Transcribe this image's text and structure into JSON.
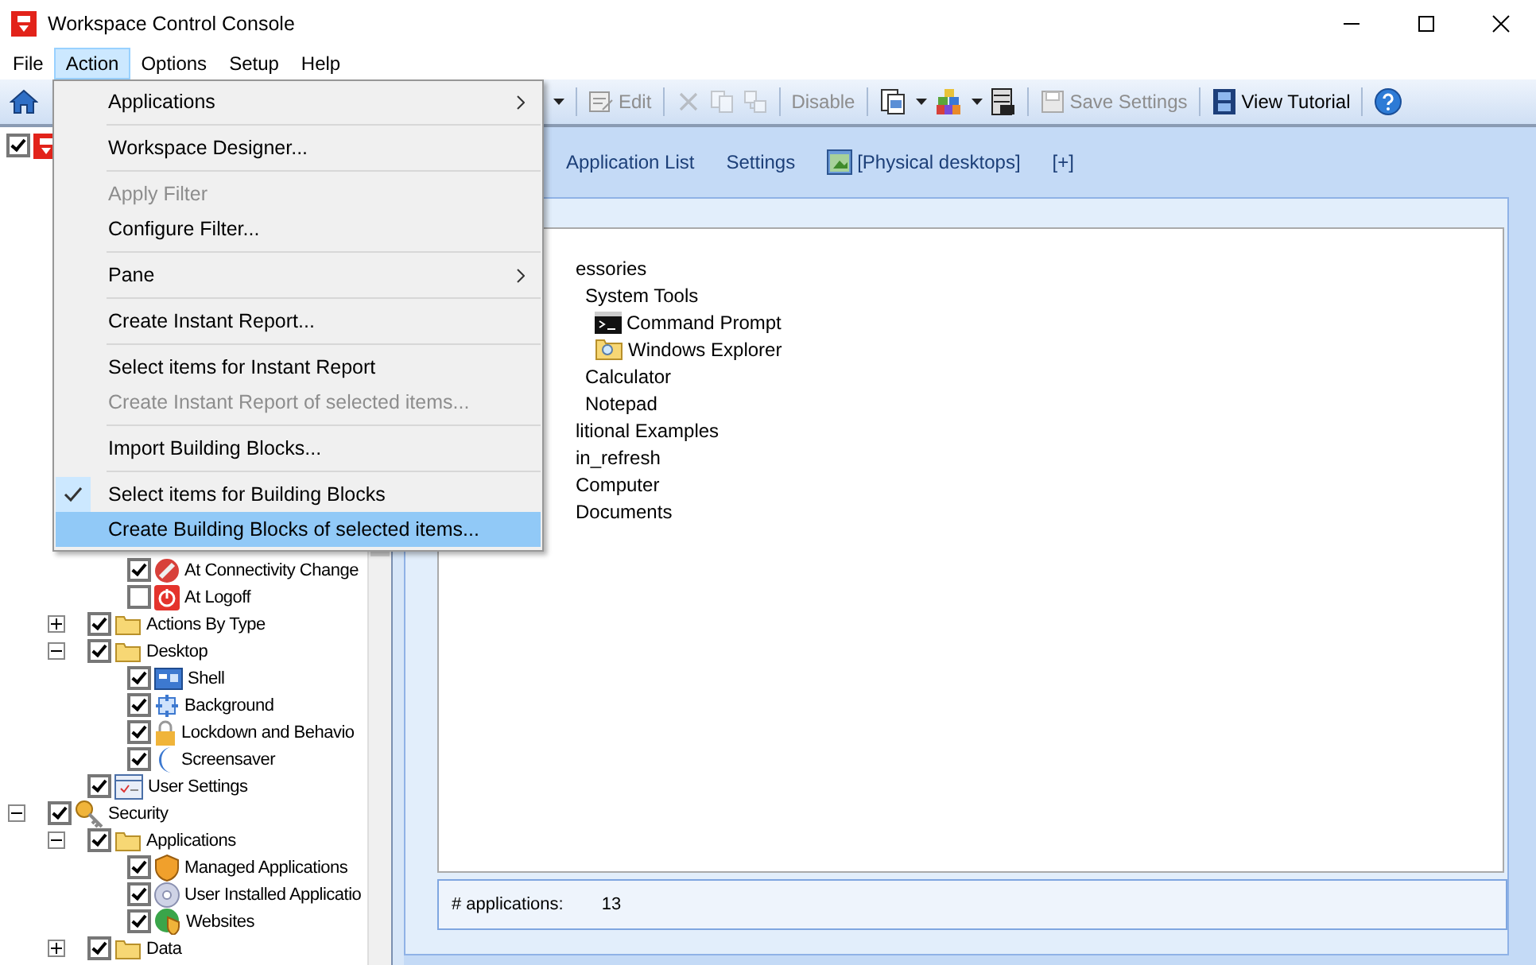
{
  "window": {
    "title": "Workspace Control Console"
  },
  "menubar": [
    {
      "label": "File",
      "selected": false
    },
    {
      "label": "Action",
      "selected": true
    },
    {
      "label": "Options",
      "selected": false
    },
    {
      "label": "Setup",
      "selected": false
    },
    {
      "label": "Help",
      "selected": false
    }
  ],
  "menu": [
    {
      "kind": "item",
      "label": "Applications",
      "submenu": true,
      "disabled": false,
      "checked": false,
      "selected": false
    },
    {
      "kind": "separator"
    },
    {
      "kind": "item",
      "label": "Workspace Designer...",
      "submenu": false,
      "disabled": false,
      "checked": false,
      "selected": false
    },
    {
      "kind": "separator"
    },
    {
      "kind": "item",
      "label": "Apply Filter",
      "submenu": false,
      "disabled": true,
      "checked": false,
      "selected": false
    },
    {
      "kind": "item",
      "label": "Configure Filter...",
      "submenu": false,
      "disabled": false,
      "checked": false,
      "selected": false
    },
    {
      "kind": "separator"
    },
    {
      "kind": "item",
      "label": "Pane",
      "submenu": true,
      "disabled": false,
      "checked": false,
      "selected": false
    },
    {
      "kind": "separator"
    },
    {
      "kind": "item",
      "label": "Create Instant Report...",
      "submenu": false,
      "disabled": false,
      "checked": false,
      "selected": false
    },
    {
      "kind": "separator"
    },
    {
      "kind": "item",
      "label": "Select items for Instant Report",
      "submenu": false,
      "disabled": false,
      "checked": false,
      "selected": false
    },
    {
      "kind": "item",
      "label": "Create Instant Report of selected items...",
      "submenu": false,
      "disabled": true,
      "checked": false,
      "selected": false
    },
    {
      "kind": "separator"
    },
    {
      "kind": "item",
      "label": "Import Building Blocks...",
      "submenu": false,
      "disabled": false,
      "checked": false,
      "selected": false
    },
    {
      "kind": "separator"
    },
    {
      "kind": "item",
      "label": "Select items for Building Blocks",
      "submenu": false,
      "disabled": false,
      "checked": true,
      "selected": false
    },
    {
      "kind": "item",
      "label": "Create Building Blocks of selected items...",
      "submenu": false,
      "disabled": false,
      "checked": false,
      "selected": true
    }
  ],
  "toolbar": {
    "left": [
      {
        "kind": "home"
      }
    ],
    "right": [
      {
        "kind": "caret"
      },
      {
        "kind": "sep"
      },
      {
        "kind": "edit",
        "label": "Edit",
        "disabled": true
      },
      {
        "kind": "sep"
      },
      {
        "kind": "cut",
        "disabled": true
      },
      {
        "kind": "copy",
        "disabled": true
      },
      {
        "kind": "paste",
        "disabled": true
      },
      {
        "kind": "sep"
      },
      {
        "kind": "text",
        "label": "Disable",
        "disabled": true
      },
      {
        "kind": "sep"
      },
      {
        "kind": "pages",
        "disabled": false
      },
      {
        "kind": "caret"
      },
      {
        "kind": "blocks",
        "disabled": false
      },
      {
        "kind": "caret"
      },
      {
        "kind": "server",
        "disabled": false
      },
      {
        "kind": "sep"
      },
      {
        "kind": "save",
        "label": "Save Settings",
        "disabled": true
      },
      {
        "kind": "sep"
      },
      {
        "kind": "film",
        "label": "View Tutorial",
        "disabled": false
      },
      {
        "kind": "sep"
      },
      {
        "kind": "help",
        "disabled": false
      }
    ]
  },
  "tree": {
    "root": {
      "checked": true
    },
    "items": [
      {
        "children": [
          {
            "children": [
              {
                "label": "At Connectivity Change",
                "kind": "plug",
                "checked": true
              },
              {
                "label": "At Logoff",
                "kind": "power",
                "checked": false
              }
            ]
          },
          {
            "label": "Actions By Type",
            "kind": "folder",
            "checked": true,
            "expanded": false
          },
          {
            "label": "Desktop",
            "kind": "folder",
            "checked": true,
            "expanded": true,
            "children": [
              {
                "label": "Shell",
                "kind": "window",
                "checked": true
              },
              {
                "label": "Background",
                "kind": "arrows",
                "checked": true
              },
              {
                "label": "Lockdown and Behavio",
                "kind": "lock",
                "checked": true
              },
              {
                "label": "Screensaver",
                "kind": "moon",
                "checked": true
              }
            ]
          },
          {
            "label": "User Settings",
            "kind": "form",
            "checked": true
          }
        ]
      },
      {
        "label": "Security",
        "kind": "key",
        "checked": true,
        "expanded": true,
        "children": [
          {
            "label": "Applications",
            "kind": "folder",
            "checked": true,
            "expanded": true,
            "children": [
              {
                "label": "Managed Applications",
                "kind": "shield",
                "checked": true
              },
              {
                "label": "User Installed Applicatio",
                "kind": "disc",
                "checked": true
              },
              {
                "label": "Websites",
                "kind": "globe",
                "checked": true
              }
            ]
          },
          {
            "label": "Data",
            "kind": "folder",
            "checked": true,
            "expanded": false
          }
        ]
      }
    ]
  },
  "tabs": [
    {
      "label": "Application List",
      "selected": false
    },
    {
      "label": "Settings",
      "selected": false
    },
    {
      "label": "[Physical desktops]",
      "kind": "desktop",
      "selected": false
    },
    {
      "label": "[+]",
      "selected": false
    }
  ],
  "app_tree": [
    {
      "label": "essories",
      "children": [
        {
          "label": "System Tools",
          "children": [
            {
              "label": "Command Prompt",
              "kind": "console"
            },
            {
              "label": "Windows Explorer",
              "kind": "explorer"
            }
          ]
        },
        {
          "label": "Calculator"
        },
        {
          "label": "Notepad"
        }
      ]
    },
    {
      "label": "litional Examples"
    },
    {
      "label": "in_refresh"
    },
    {
      "label": "Computer"
    },
    {
      "label": "Documents"
    }
  ],
  "status": {
    "label": "# applications:",
    "value": "13"
  }
}
